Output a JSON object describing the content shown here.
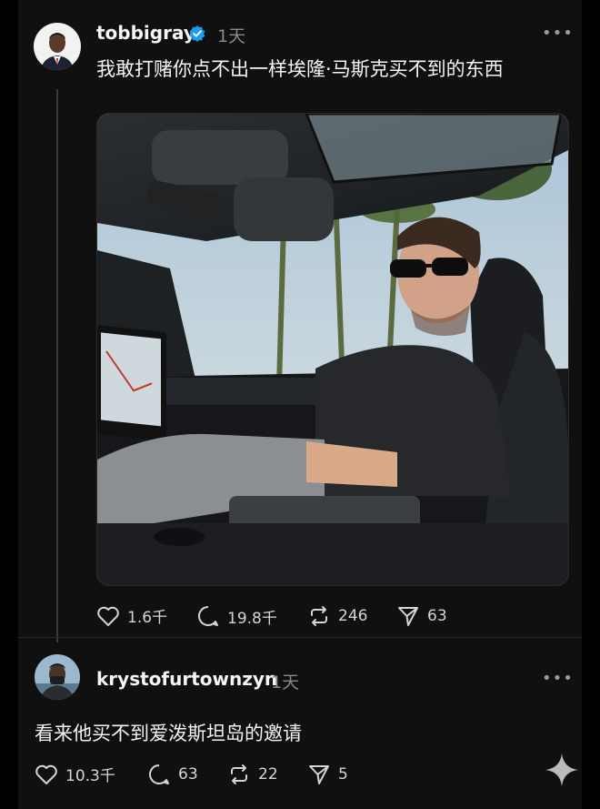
{
  "post": {
    "username": "tobbigray",
    "time": "1天",
    "more": "•••",
    "text": "我敢打赌你点不出一样埃隆·马斯克买不到的东西",
    "stats": {
      "likes": "1.6千",
      "replies": "19.8千",
      "reposts": "246",
      "shares": "63"
    }
  },
  "reply": {
    "username": "krystofurtownzyn",
    "time": "1天",
    "more": "•••",
    "text": "看来他买不到爱泼斯坦岛的邀请",
    "stats": {
      "likes": "10.3千",
      "replies": "63",
      "reposts": "22",
      "shares": "5"
    }
  },
  "colors": {
    "background": "#101010",
    "verified": "#1d9bf0",
    "text": "#f5f5f5",
    "muted": "#8a8a8a"
  },
  "icons": [
    "heart-icon",
    "comment-icon",
    "repost-icon",
    "share-icon",
    "verified-badge-icon",
    "more-icon",
    "sparkle-icon"
  ]
}
